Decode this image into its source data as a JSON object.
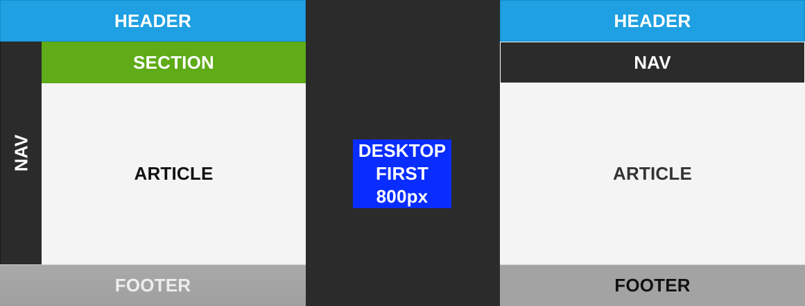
{
  "desktop_layout": {
    "header": "HEADER",
    "nav": "NAV",
    "section": "SECTION",
    "article": "ARTICLE",
    "footer": "FOOTER"
  },
  "badge": {
    "line1": "DESKTOP",
    "line2": "FIRST",
    "line3": "800px"
  },
  "mobile_layout": {
    "header": "HEADER",
    "nav": "NAV",
    "article": "ARTICLE",
    "footer": "FOOTER"
  },
  "colors": {
    "header": "#1ea0e2",
    "nav": "#2b2b2b",
    "section": "#5fab18",
    "article": "#f4f4f4",
    "footer": "#a3a3a3",
    "badge": "#0a2dff"
  }
}
